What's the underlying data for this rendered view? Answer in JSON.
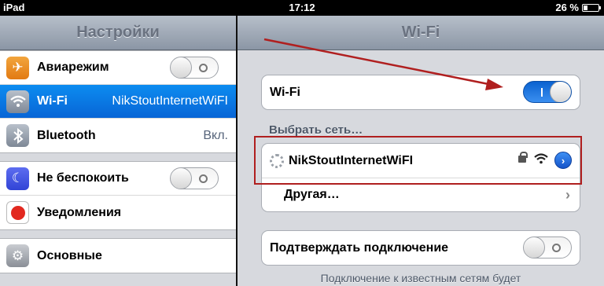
{
  "statusbar": {
    "device": "iPad",
    "time": "17:12",
    "battery": "26 %",
    "battery_level": 0.26
  },
  "left": {
    "title": "Настройки",
    "groups": [
      [
        {
          "label": "Авиарежим",
          "icon": "airplane-icon",
          "switch": "off"
        },
        {
          "label": "Wi-Fi",
          "icon": "wifi-icon",
          "value": "NikStoutInternetWiFI",
          "selected": true
        },
        {
          "label": "Bluetooth",
          "icon": "bluetooth-icon",
          "value": "Вкл."
        }
      ],
      [
        {
          "label": "Не беспокоить",
          "icon": "moon-icon",
          "switch": "off"
        },
        {
          "label": "Уведомления",
          "icon": "notifications-icon"
        }
      ],
      [
        {
          "label": "Основные",
          "icon": "gear-icon"
        }
      ]
    ]
  },
  "right": {
    "title": "Wi-Fi",
    "wifi_label": "Wi-Fi",
    "wifi_switch": "on",
    "choose_network": "Выбрать сеть…",
    "network_name": "NikStoutInternetWiFI",
    "other_label": "Другая…",
    "ask_join_label": "Подтверждать подключение",
    "ask_join_switch": "off",
    "footnote": "Подключение к известным сетям будет"
  },
  "annotations": {
    "arrow_color": "#b01f1f",
    "highlight_color": "#b01f1f"
  }
}
